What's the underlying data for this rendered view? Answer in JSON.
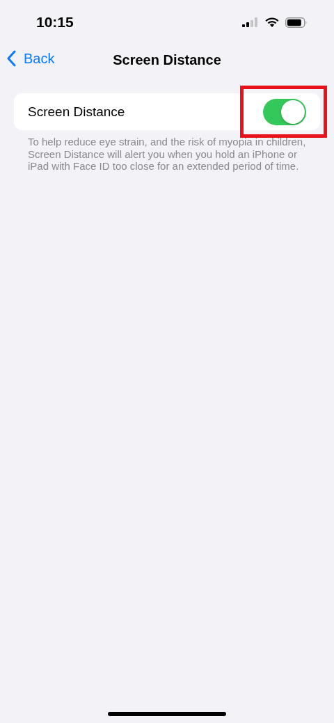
{
  "status_bar": {
    "time": "10:15"
  },
  "nav": {
    "back": "Back",
    "title": "Screen Distance"
  },
  "setting": {
    "label": "Screen Distance",
    "on": true,
    "highlighted": true
  },
  "footer": "To help reduce eye strain, and the risk of myopia in children, Screen Distance will alert you when you hold an iPhone or iPad with Face ID too close for an extended period of time."
}
